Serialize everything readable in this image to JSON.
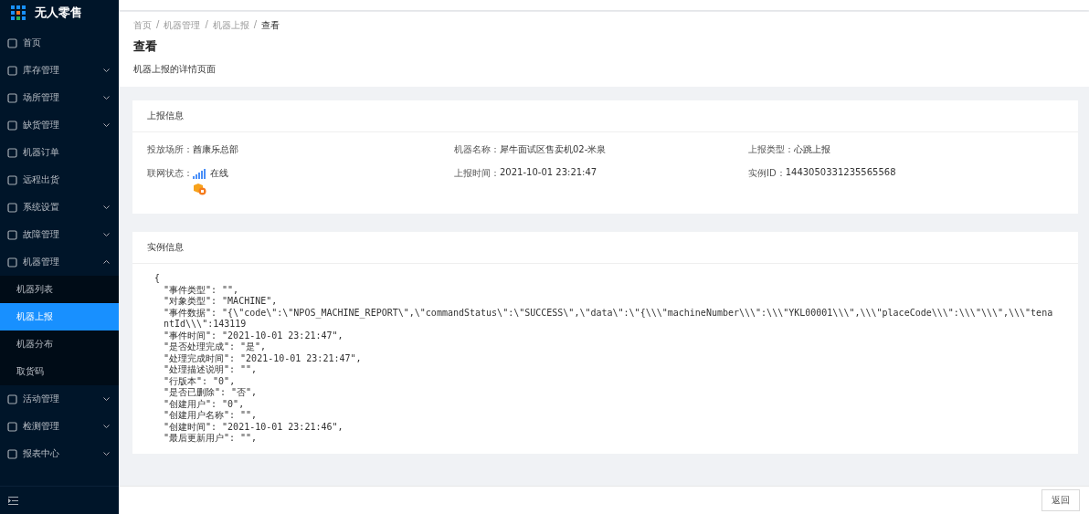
{
  "app": {
    "title": "无人零售"
  },
  "sidebar": {
    "items": [
      {
        "label": "首页",
        "kind": "link",
        "selected": false
      },
      {
        "label": "库存管理",
        "kind": "group",
        "expanded": false,
        "selected": false
      },
      {
        "label": "场所管理",
        "kind": "group",
        "expanded": false,
        "selected": false
      },
      {
        "label": "缺货管理",
        "kind": "group",
        "expanded": false,
        "selected": false
      },
      {
        "label": "机器订单",
        "kind": "link",
        "selected": false
      },
      {
        "label": "远程出货",
        "kind": "link",
        "selected": false
      },
      {
        "label": "系统设置",
        "kind": "group",
        "expanded": false,
        "selected": false
      },
      {
        "label": "故障管理",
        "kind": "group",
        "expanded": false,
        "selected": false
      },
      {
        "label": "机器管理",
        "kind": "group",
        "expanded": true,
        "selected": false,
        "children": [
          {
            "label": "机器列表",
            "selected": false
          },
          {
            "label": "机器上报",
            "selected": true
          },
          {
            "label": "机器分布",
            "selected": false
          },
          {
            "label": "取货码",
            "selected": false
          }
        ]
      },
      {
        "label": "活动管理",
        "kind": "group",
        "expanded": false,
        "selected": false
      },
      {
        "label": "检测管理",
        "kind": "group",
        "expanded": false,
        "selected": false
      },
      {
        "label": "报表中心",
        "kind": "group",
        "expanded": false,
        "selected": false
      }
    ]
  },
  "breadcrumb": [
    "首页",
    "机器管理",
    "机器上报",
    "查看"
  ],
  "breadcrumb_separator": "/",
  "page": {
    "title": "查看",
    "description": "机器上报的详情页面"
  },
  "report_card": {
    "title": "上报信息",
    "fields": [
      {
        "label": "投放场所：",
        "value": "酋康乐总部",
        "kind": "text"
      },
      {
        "label": "机器名称：",
        "value": "犀牛面试区售卖机02-米泉",
        "kind": "text"
      },
      {
        "label": "上报类型：",
        "value": "心跳上报",
        "kind": "text"
      },
      {
        "label": "联网状态：",
        "value": "在线",
        "kind": "network"
      },
      {
        "label": "上报时间：",
        "value": "2021-10-01 23:21:47",
        "kind": "text"
      },
      {
        "label": "实例ID：",
        "value": "1443050331235565568",
        "kind": "text"
      }
    ]
  },
  "instance_card": {
    "title": "实例信息",
    "code_open": "{",
    "code_lines": [
      "\"事件类型\": \"\",",
      "\"对象类型\": \"MACHINE\",",
      "\"事件数据\": \"{\\\"code\\\":\\\"NPOS_MACHINE_REPORT\\\",\\\"commandStatus\\\":\\\"SUCCESS\\\",\\\"data\\\":\\\"{\\\\\\\"machineNumber\\\\\\\":\\\\\\\"YKL00001\\\\\\\",\\\\\\\"placeCode\\\\\\\":\\\\\\\"\\\\\\\",\\\\\\\"tenantId\\\\\\\":143119",
      "\"事件时间\": \"2021-10-01 23:21:47\",",
      "\"是否处理完成\": \"是\",",
      "\"处理完成时间\": \"2021-10-01 23:21:47\",",
      "\"处理描述说明\": \"\",",
      "\"行版本\": \"0\",",
      "\"是否已删除\": \"否\",",
      "\"创建用户\": \"0\",",
      "\"创建用户名称\": \"\",",
      "\"创建时间\": \"2021-10-01 23:21:46\",",
      "\"最后更新用户\": \"\","
    ]
  },
  "footer": {
    "button": "返回"
  }
}
